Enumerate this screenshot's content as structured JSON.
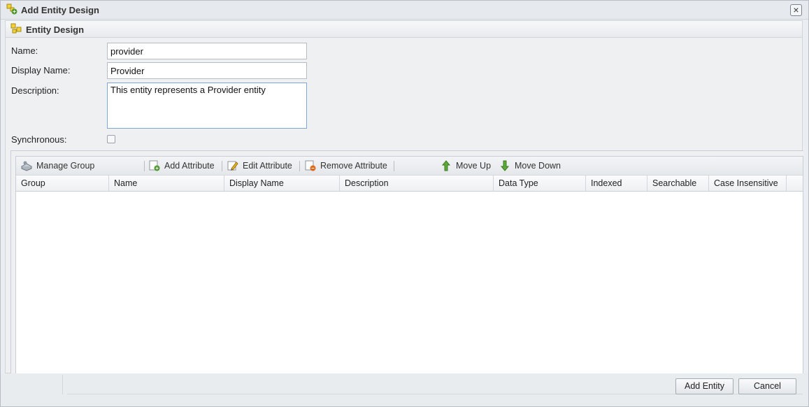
{
  "window": {
    "title": "Add Entity Design",
    "close_symbol": "×"
  },
  "panel": {
    "title": "Entity Design"
  },
  "form": {
    "name_label": "Name:",
    "name_value": "provider",
    "display_name_label": "Display Name:",
    "display_name_value": "Provider",
    "description_label": "Description:",
    "description_value": "This entity represents a Provider entity",
    "synchronous_label": "Synchronous:",
    "synchronous_checked": false
  },
  "toolbar": {
    "manage_group": "Manage Group",
    "add_attribute": "Add Attribute",
    "edit_attribute": "Edit Attribute",
    "remove_attribute": "Remove Attribute",
    "move_up": "Move Up",
    "move_down": "Move Down"
  },
  "grid": {
    "columns": [
      "Group",
      "Name",
      "Display Name",
      "Description",
      "Data Type",
      "Indexed",
      "Searchable",
      "Case Insensitive"
    ],
    "rows": []
  },
  "footer": {
    "add_entity": "Add Entity",
    "cancel": "Cancel"
  },
  "colors": {
    "accent_green": "#4f9a2f",
    "icon_yellow": "#e8c21e",
    "remove_orange": "#e06a1c"
  }
}
